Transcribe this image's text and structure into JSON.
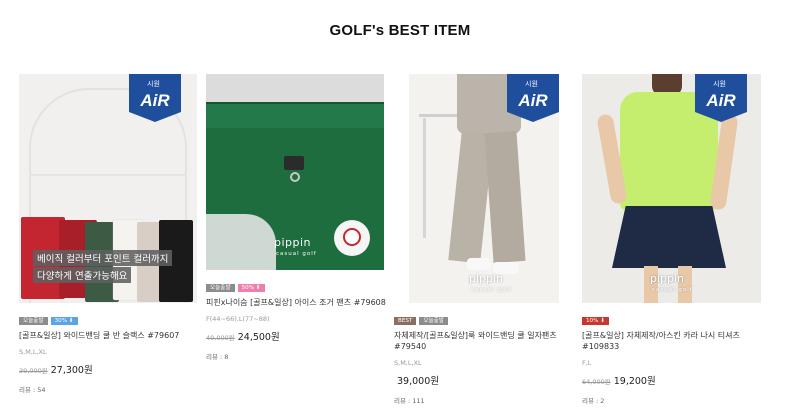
{
  "section": {
    "title": "GOLF's BEST ITEM"
  },
  "air_badge": {
    "top_text": "시원",
    "main_text": "AiR",
    "color": "#1f4f9c"
  },
  "products": [
    {
      "badges": [
        {
          "text": "오늘출발",
          "color": "gray"
        },
        {
          "text": "30% ⬇",
          "color": "blue"
        }
      ],
      "name": "[골프&일상] 와이드밴딩 쿨 반 슬랙스 #79607",
      "options": "S,M,L,XL",
      "original_price": "39,000원",
      "price": "27,300원",
      "review": "리뷰 : 54",
      "image": {
        "has_air": true,
        "caption_line1": "베이직 컬러부터 포인트 컬러까지",
        "caption_line2": "다양하게 연출가능해요",
        "colors": [
          "#c8242e",
          "#3e5745",
          "#ffffff",
          "#d8cdc4",
          "#1a1a1a"
        ]
      }
    },
    {
      "badges": [
        {
          "text": "오늘출발",
          "color": "gray"
        },
        {
          "text": "50% ⬇",
          "color": "pink"
        }
      ],
      "name": "피핀x나이슴 [골프&일상] 아이스 조거 팬츠 #79608",
      "options": "F(44~66),L(77~88)",
      "original_price": "49,000원",
      "price": "24,500원",
      "review": "리뷰 : 8",
      "image": {
        "has_air": false,
        "brand": "pippin",
        "brand_sub": "casual golf",
        "color": "#1f6f3f"
      }
    },
    {
      "badges": [
        {
          "text": "BEST",
          "color": "brown"
        },
        {
          "text": "오늘출발",
          "color": "gray"
        }
      ],
      "name": "자체제작/[골프&일상]룩 와이드밴딩 쿨 일자팬츠 #79540",
      "options": "S,M,L,XL",
      "original_price": "",
      "price": "39,000원",
      "review": "리뷰 : 111",
      "image": {
        "has_air": true,
        "brand": "pippin",
        "brand_sub": "casual golf",
        "color": "#b9b2a7"
      }
    },
    {
      "badges": [
        {
          "text": "10% ⬇",
          "color": "red"
        }
      ],
      "name": "[골프&일상] 자체제작/아스킨 카라 나시 티셔츠 #109833",
      "options": "F,L",
      "original_price": "64,000원",
      "price": "19,200원",
      "review": "리뷰 : 2",
      "image": {
        "has_air": true,
        "brand": "pippin",
        "brand_sub": "casual golf",
        "color": "#c5ee6e"
      }
    }
  ]
}
